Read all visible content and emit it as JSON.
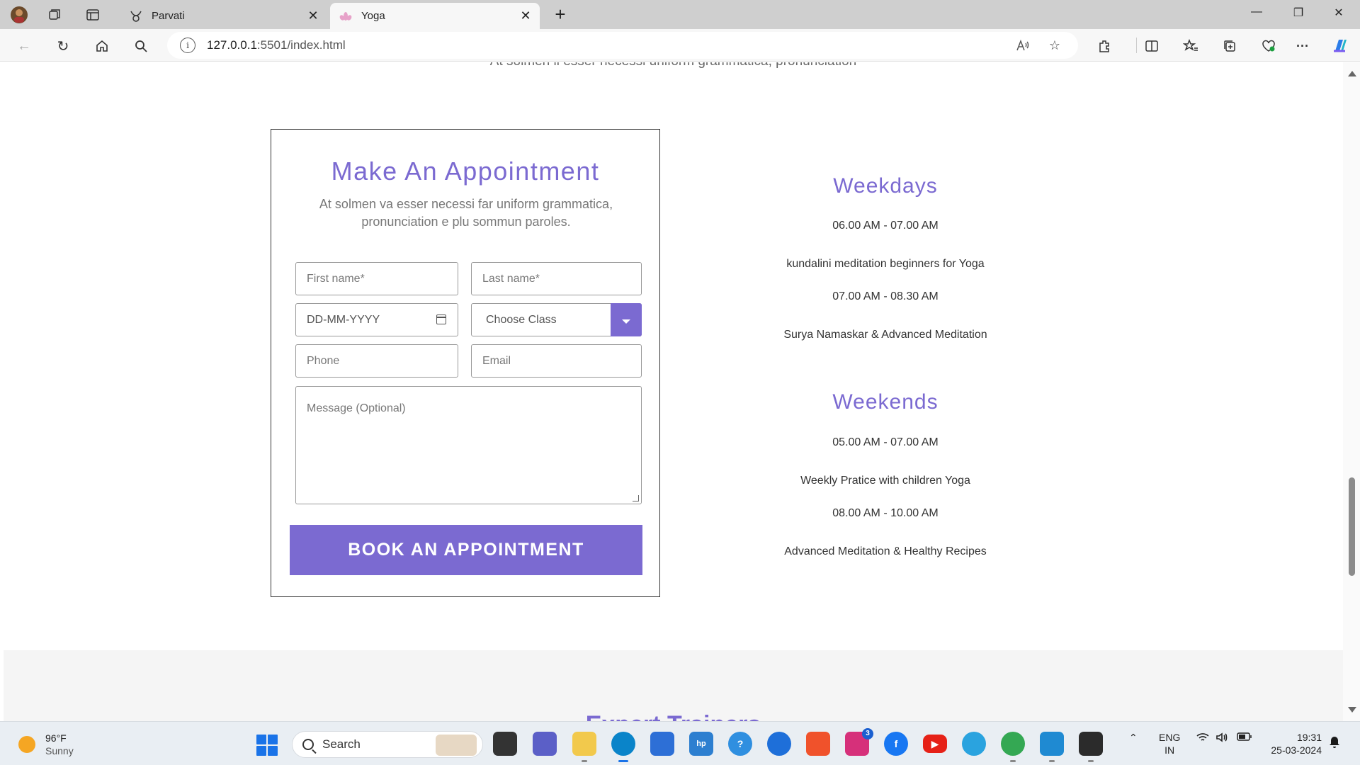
{
  "browser": {
    "tabs": [
      {
        "title": "Parvati",
        "active": false
      },
      {
        "title": "Yoga",
        "active": true
      }
    ],
    "url_host": "127.0.0.1",
    "url_rest": ":5501/index.html",
    "new_tab_symbol": "+",
    "window": {
      "minimize": "—",
      "restore": "❐",
      "close": "✕"
    }
  },
  "page": {
    "top_line": "At solmen li esser necessi uniform grammatica, pronunciation",
    "form": {
      "title": "Make An Appointment",
      "subtitle": "At solmen va esser necessi far uniform grammatica, pronunciation e plu sommun paroles.",
      "first_name_placeholder": "First name*",
      "last_name_placeholder": "Last name*",
      "date_placeholder": "DD-MM-YYYY",
      "class_select_value": "Choose Class",
      "phone_placeholder": "Phone",
      "email_placeholder": "Email",
      "message_placeholder": "Message (Optional)",
      "submit_label": "BOOK AN APPOINTMENT"
    },
    "schedule": {
      "weekdays": {
        "heading": "Weekdays",
        "slots": [
          {
            "time": "06.00 AM - 07.00 AM",
            "desc": "kundalini meditation beginners for Yoga"
          },
          {
            "time": "07.00 AM - 08.30 AM",
            "desc": "Surya Namaskar & Advanced Meditation"
          }
        ]
      },
      "weekends": {
        "heading": "Weekends",
        "slots": [
          {
            "time": "05.00 AM - 07.00 AM",
            "desc": "Weekly Pratice with children Yoga"
          },
          {
            "time": "08.00 AM - 10.00 AM",
            "desc": "Advanced Meditation & Healthy Recipes"
          }
        ]
      }
    },
    "next_section_heading": "Expert Trainers",
    "accent_color": "#7b6ad1"
  },
  "taskbar": {
    "weather_temp": "96°F",
    "weather_cond": "Sunny",
    "search_label": "Search",
    "instagram_badge": "3",
    "lang_1": "ENG",
    "lang_2": "IN",
    "time": "19:31",
    "date": "25-03-2024"
  }
}
